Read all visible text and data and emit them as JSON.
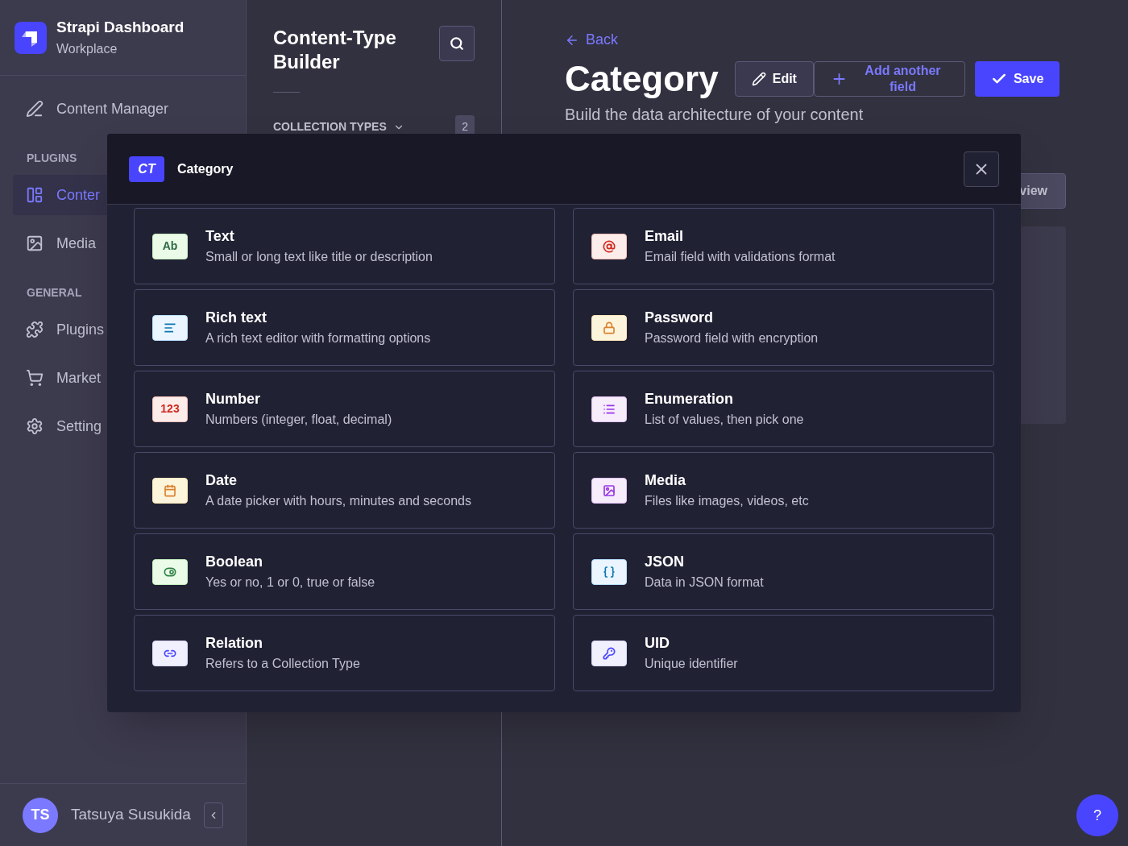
{
  "sidebar": {
    "brand": {
      "title": "Strapi Dashboard",
      "subtitle": "Workplace"
    },
    "nav": [
      {
        "kind": "pen",
        "label": "Content Manager",
        "selected": false
      },
      {
        "kind": "heading",
        "label": "PLUGINS"
      },
      {
        "kind": "layout",
        "label": "Conter",
        "selected": true
      },
      {
        "kind": "image",
        "label": "Media",
        "selected": false
      },
      {
        "kind": "heading",
        "label": "GENERAL"
      },
      {
        "kind": "puzzle",
        "label": "Plugins",
        "selected": false
      },
      {
        "kind": "cart",
        "label": "Market",
        "selected": false
      },
      {
        "kind": "gear",
        "label": "Setting",
        "selected": false
      }
    ],
    "user": {
      "initials": "TS",
      "name": "Tatsuya Susukida"
    }
  },
  "builder_panel": {
    "title": "Content-Type Builder",
    "section": "COLLECTION TYPES",
    "count": "2"
  },
  "header": {
    "back": "Back",
    "title": "Category",
    "subtitle": "Build the data architecture of your content",
    "buttons": [
      {
        "kind": "edit",
        "label": "Edit"
      },
      {
        "kind": "add",
        "label": "Add another field"
      },
      {
        "kind": "save",
        "label": "Save"
      }
    ],
    "view_button": "view"
  },
  "modal": {
    "badge": "CT",
    "title": "Category",
    "fields": [
      {
        "kind": "text",
        "glyph": "Ab",
        "name": "Text",
        "description": "Small or long text like title or description"
      },
      {
        "kind": "email",
        "name": "Email",
        "description": "Email field with validations format"
      },
      {
        "kind": "richtext",
        "name": "Rich text",
        "description": "A rich text editor with formatting options"
      },
      {
        "kind": "password",
        "name": "Password",
        "description": "Password field with encryption"
      },
      {
        "kind": "number",
        "glyph": "123",
        "name": "Number",
        "description": "Numbers (integer, float, decimal)"
      },
      {
        "kind": "enumeration",
        "name": "Enumeration",
        "description": "List of values, then pick one"
      },
      {
        "kind": "date",
        "name": "Date",
        "description": "A date picker with hours, minutes and seconds"
      },
      {
        "kind": "media",
        "name": "Media",
        "description": "Files like images, videos, etc"
      },
      {
        "kind": "boolean",
        "name": "Boolean",
        "description": "Yes or no, 1 or 0, true or false"
      },
      {
        "kind": "json",
        "name": "JSON",
        "description": "Data in JSON format"
      },
      {
        "kind": "relation",
        "name": "Relation",
        "description": "Refers to a Collection Type"
      },
      {
        "kind": "uid",
        "name": "UID",
        "description": "Unique identifier"
      }
    ]
  },
  "help_button": "?"
}
